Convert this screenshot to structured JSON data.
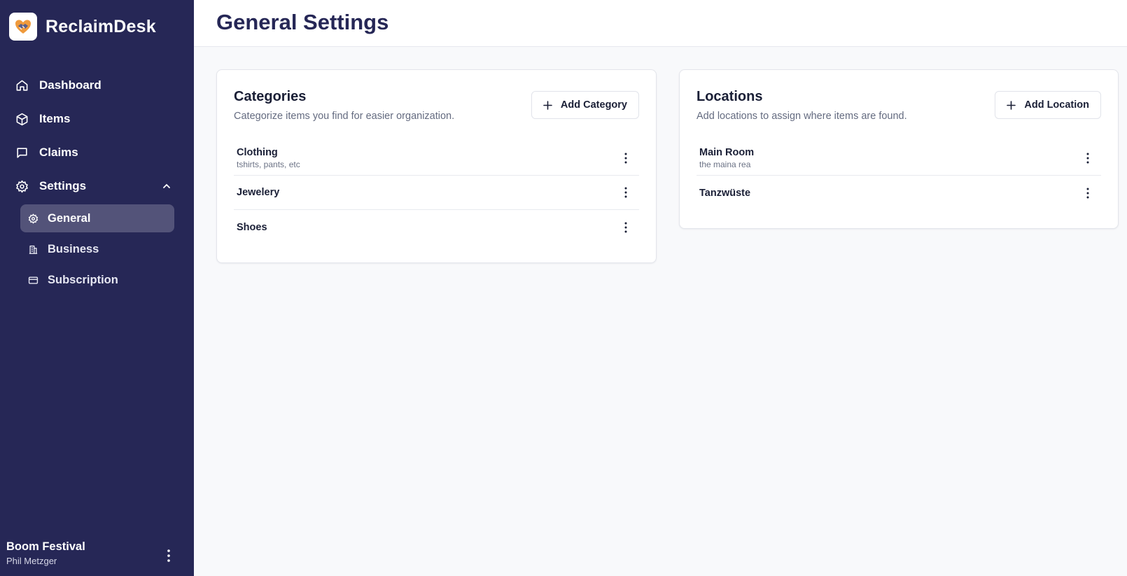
{
  "app": {
    "name": "ReclaimDesk"
  },
  "sidebar": {
    "items": [
      {
        "label": "Dashboard",
        "icon": "home-icon"
      },
      {
        "label": "Items",
        "icon": "box-icon"
      },
      {
        "label": "Claims",
        "icon": "chat-icon"
      },
      {
        "label": "Settings",
        "icon": "gear-icon",
        "expanded": true
      }
    ],
    "settings_items": [
      {
        "label": "General",
        "icon": "gear-icon",
        "active": true
      },
      {
        "label": "Business",
        "icon": "building-icon"
      },
      {
        "label": "Subscription",
        "icon": "card-icon"
      }
    ],
    "account": {
      "organization": "Boom Festival",
      "user": "Phil Metzger"
    }
  },
  "header": {
    "title": "General Settings"
  },
  "categories": {
    "title": "Categories",
    "description": "Categorize items you find for easier organization.",
    "add_label": "Add Category",
    "items": [
      {
        "name": "Clothing",
        "description": "tshirts, pants, etc"
      },
      {
        "name": "Jewelery",
        "description": ""
      },
      {
        "name": "Shoes",
        "description": ""
      }
    ]
  },
  "locations": {
    "title": "Locations",
    "description": "Add locations to assign where items are found.",
    "add_label": "Add Location",
    "items": [
      {
        "name": "Main Room",
        "description": "the maina rea"
      },
      {
        "name": "Tanzwüste",
        "description": ""
      }
    ]
  },
  "colors": {
    "sidebar_bg": "#262756",
    "active_item_bg": "#535379",
    "title": "#262756"
  }
}
